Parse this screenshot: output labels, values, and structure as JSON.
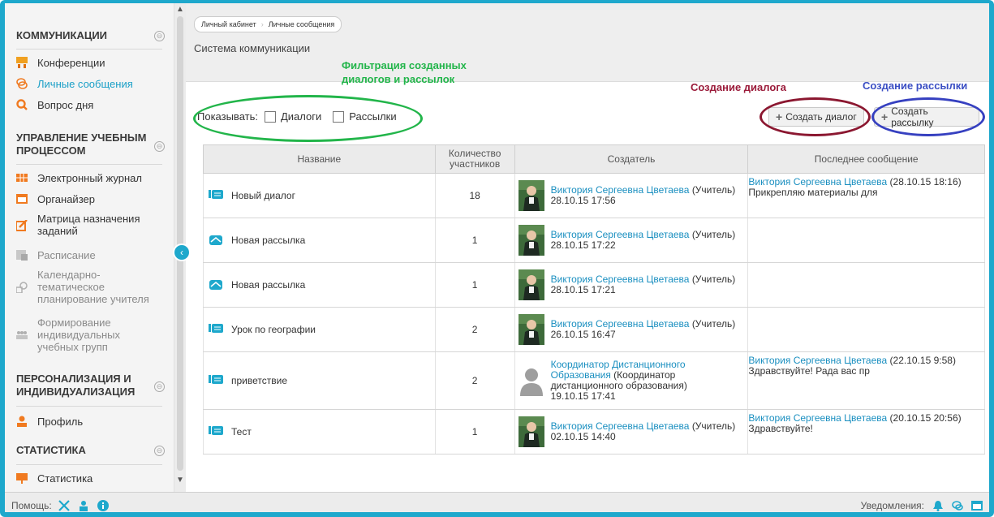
{
  "sidebar": {
    "sections": [
      {
        "title": "КОММУНИКАЦИИ"
      },
      {
        "title_lines": [
          "УПРАВЛЕНИЕ УЧЕБНЫМ",
          "ПРОЦЕССОМ"
        ]
      },
      {
        "title_lines": [
          "ПЕРСОНАЛИЗАЦИЯ И",
          "ИНДИВИДУАЛИЗАЦИЯ"
        ]
      },
      {
        "title": "СТАТИСТИКА"
      }
    ],
    "toggle_symbol": "⊖",
    "items": {
      "conferences": "Конференции",
      "messages": "Личные сообщения",
      "question": "Вопрос дня",
      "journal": "Электронный журнал",
      "organizer": "Органайзер",
      "matrix": [
        "Матрица назначения",
        "заданий"
      ],
      "schedule": "Расписание",
      "calendar": [
        "Календарно-",
        "тематическое",
        "планирование учителя"
      ],
      "groups": [
        "Формирование",
        "индивидуальных",
        "учебных групп"
      ],
      "profile": "Профиль",
      "statistics": "Статистика"
    }
  },
  "header": {
    "breadcrumb": [
      "Личный кабинет",
      "Личные сообщения"
    ],
    "page_title": "Система коммуникации"
  },
  "annotations": {
    "filter": [
      "Фильтрация созданных",
      "диалогов и рассылок"
    ],
    "create_dialog": "Создание диалога",
    "create_mailing": "Создание рассылки"
  },
  "filter": {
    "label": "Показывать:",
    "dialogs": "Диалоги",
    "mailings": "Рассылки"
  },
  "toolbar": {
    "create_dialog": "Создать диалог",
    "create_mailing": "Создать рассылку"
  },
  "table": {
    "headers": [
      "Название",
      "Количество участников",
      "Создатель",
      "Последнее сообщение"
    ],
    "header_count_lines": [
      "Количество",
      "участников"
    ],
    "rows": [
      {
        "type": "dialog",
        "name": "Новый диалог",
        "count": "18",
        "creator": "Виктория Сергеевна Цветаева",
        "role": "(Учитель)",
        "date": "28.10.15 17:56",
        "last_author": "Виктория Сергеевна Цветаева",
        "last_date": "(28.10.15 18:16)",
        "last_text": "Прикрепляю материалы для"
      },
      {
        "type": "mailing",
        "name": "Новая рассылка",
        "count": "1",
        "creator": "Виктория Сергеевна Цветаева",
        "role": "(Учитель)",
        "date": "28.10.15 17:22",
        "last_author": "",
        "last_date": "",
        "last_text": ""
      },
      {
        "type": "mailing",
        "name": "Новая рассылка",
        "count": "1",
        "creator": "Виктория Сергеевна Цветаева",
        "role": "(Учитель)",
        "date": "28.10.15 17:21",
        "last_author": "",
        "last_date": "",
        "last_text": ""
      },
      {
        "type": "dialog",
        "name": "Урок по географии",
        "count": "2",
        "creator": "Виктория Сергеевна Цветаева",
        "role": "(Учитель)",
        "date": "26.10.15 16:47",
        "last_author": "",
        "last_date": "",
        "last_text": ""
      },
      {
        "type": "dialog",
        "name": "приветствие",
        "count": "2",
        "creator": "Координатор Дистанционного Образования",
        "role": "(Координатор дистанционного образования)",
        "date": "19.10.15 17:41",
        "last_author": "Виктория Сергеевна Цветаева",
        "last_date": "(22.10.15 9:58)",
        "last_text": "Здравствуйте! Рада вас пр"
      },
      {
        "type": "dialog",
        "name": "Тест",
        "count": "1",
        "creator": "Виктория Сергеевна Цветаева",
        "role": "(Учитель)",
        "date": "02.10.15 14:40",
        "last_author": "Виктория Сергеевна Цветаева",
        "last_date": "(20.10.15 20:56)",
        "last_text": "Здравствуйте!"
      }
    ]
  },
  "footer": {
    "help": "Помощь:",
    "notifications": "Уведомления:"
  },
  "colors": {
    "accent": "#1ea8cc",
    "link": "#1a8fc0",
    "annotation_green": "#22b54a",
    "annotation_red": "#9b1b3a",
    "annotation_blue": "#3b4fc4"
  }
}
